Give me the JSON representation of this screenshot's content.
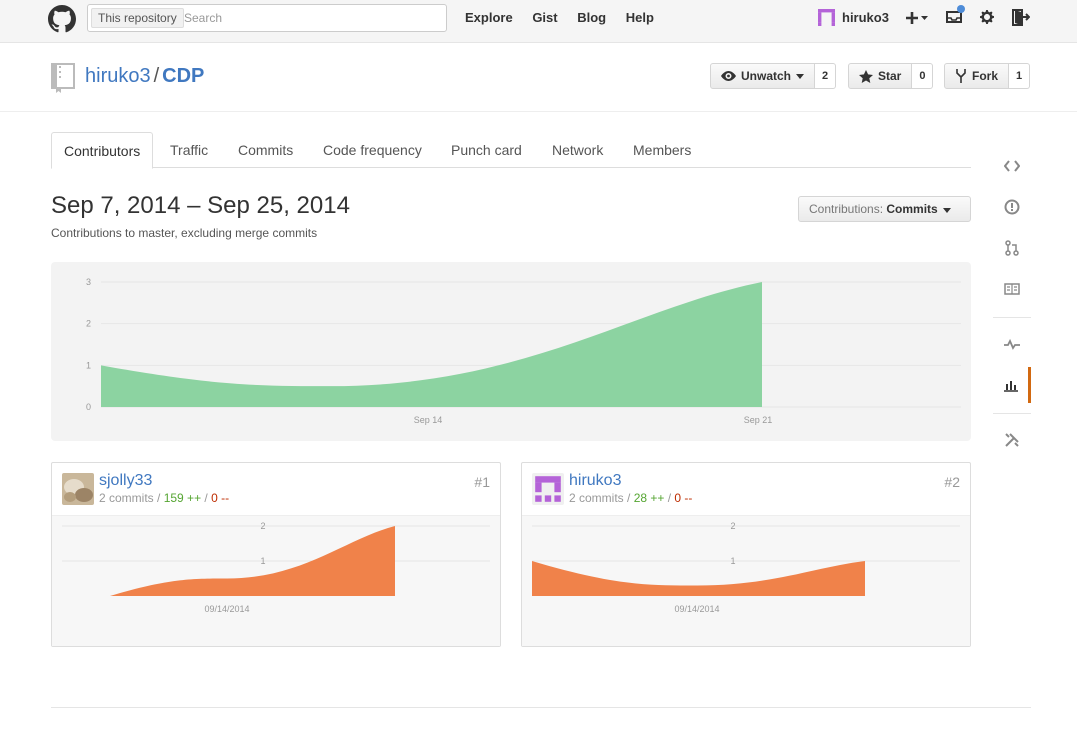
{
  "header": {
    "search_scope": "This repository",
    "search_placeholder": "Search",
    "nav": [
      "Explore",
      "Gist",
      "Blog",
      "Help"
    ],
    "username": "hiruko3"
  },
  "repo": {
    "owner": "hiruko3",
    "separator": "/",
    "name": "CDP",
    "watch_label": "Unwatch",
    "watch_count": "2",
    "star_label": "Star",
    "star_count": "0",
    "fork_label": "Fork",
    "fork_count": "1"
  },
  "tabs": [
    "Contributors",
    "Traffic",
    "Commits",
    "Code frequency",
    "Punch card",
    "Network",
    "Members"
  ],
  "selected_tab": "Contributors",
  "range": {
    "title": "Sep 7, 2014 – Sep 25, 2014",
    "subtitle": "Contributions to master, excluding merge commits",
    "contrib_prefix": "Contributions:",
    "contrib_value": "Commits"
  },
  "colors": {
    "main_area": "#8cd3a1",
    "person_area": "#f0824a",
    "link": "#4078c0",
    "accent_active": "#d26911"
  },
  "chart_data": [
    {
      "type": "area",
      "title": "",
      "x_tick_labels": [
        "Sep 14",
        "Sep 21"
      ],
      "y_tick_labels": [
        "0",
        "1",
        "2",
        "3"
      ],
      "ylim": [
        0,
        3
      ],
      "x": [
        "Sep 7",
        "Sep 14",
        "Sep 21"
      ],
      "values": [
        1,
        0.5,
        3
      ],
      "grid": true
    },
    {
      "type": "area",
      "title": "",
      "x_tick_labels": [
        "09/14/2014"
      ],
      "y_tick_labels": [
        "1",
        "2"
      ],
      "ylim": [
        0,
        2
      ],
      "x": [
        "09/07/2014",
        "09/14/2014",
        "09/21/2014"
      ],
      "values": [
        0,
        0.5,
        2
      ],
      "grid": true
    },
    {
      "type": "area",
      "title": "",
      "x_tick_labels": [
        "09/14/2014"
      ],
      "y_tick_labels": [
        "1",
        "2"
      ],
      "ylim": [
        0,
        2
      ],
      "x": [
        "09/07/2014",
        "09/14/2014",
        "09/21/2014"
      ],
      "values": [
        1,
        0.3,
        1
      ],
      "grid": true
    }
  ],
  "contributors": [
    {
      "name": "sjolly33",
      "commits": "2 commits",
      "sep1": " / ",
      "additions": "159 ++",
      "sep2": " / ",
      "deletions": "0 --",
      "rank": "#1"
    },
    {
      "name": "hiruko3",
      "commits": "2 commits",
      "sep1": " / ",
      "additions": "28 ++",
      "sep2": " / ",
      "deletions": "0 --",
      "rank": "#2"
    }
  ],
  "sidebar_icons": [
    "code-icon",
    "issues-icon",
    "pull-requests-icon",
    "wiki-icon",
    "pulse-icon",
    "graphs-icon",
    "settings-icon"
  ]
}
